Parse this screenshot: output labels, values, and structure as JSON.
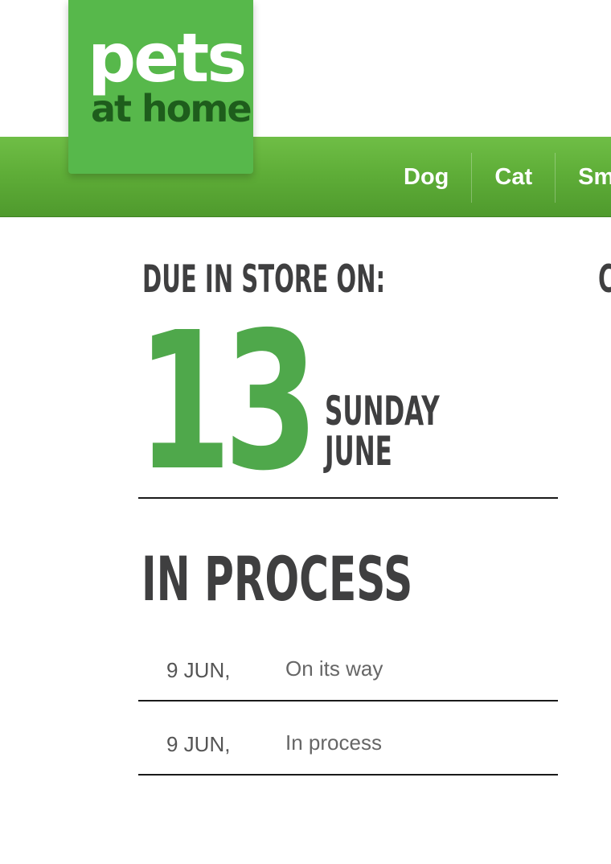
{
  "brand": {
    "logo_line1": "pets",
    "logo_line2": "at home",
    "primary_green": "#57b84b",
    "number_green": "#4fa84b",
    "dark_green_text": "#1e5d1c"
  },
  "nav": {
    "items": [
      {
        "label": "Dog"
      },
      {
        "label": "Cat"
      },
      {
        "label": "Sm"
      }
    ]
  },
  "delivery": {
    "due_label": "DUE IN STORE ON:",
    "right_column_clipped": "C",
    "day": "13",
    "weekday": "SUNDAY",
    "month": "JUNE"
  },
  "status": {
    "title": "IN PROCESS",
    "events": [
      {
        "date": "9 JUN,",
        "description": "On its way"
      },
      {
        "date": "9 JUN,",
        "description": "In process"
      }
    ]
  }
}
